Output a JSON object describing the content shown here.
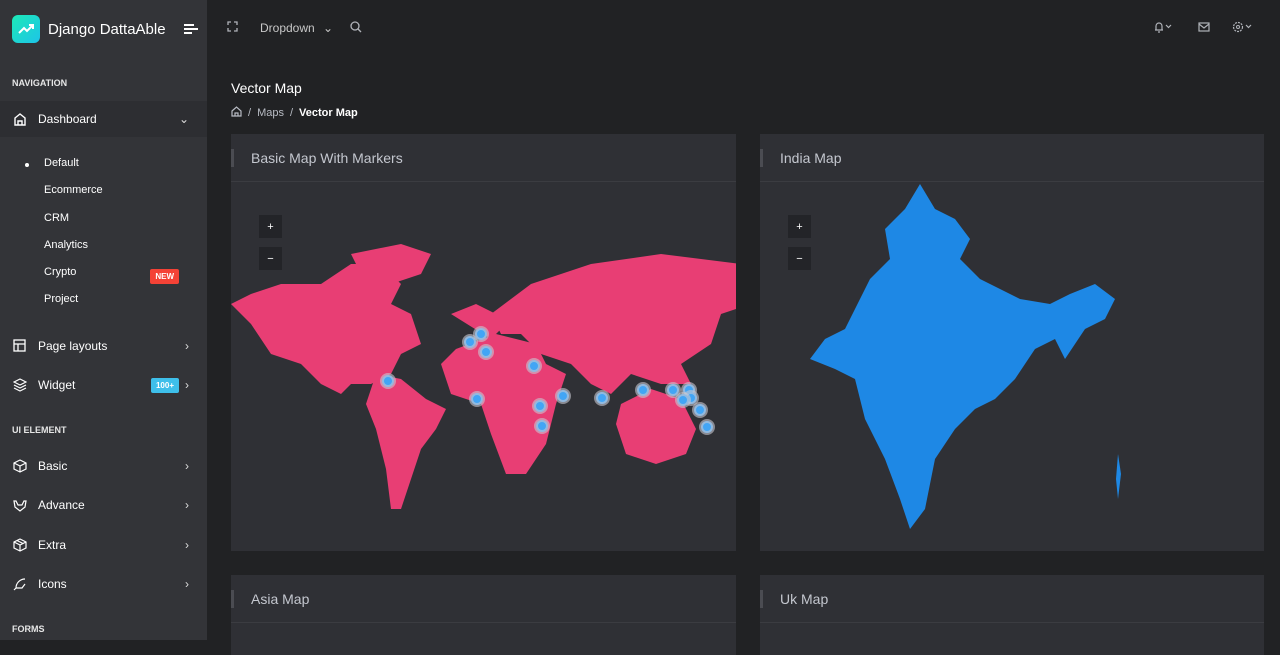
{
  "brand": {
    "name": "Django DattaAble"
  },
  "topbar": {
    "dropdown": "Dropdown"
  },
  "sidebar": {
    "captions": [
      "NAVIGATION",
      "UI ELEMENT",
      "FORMS"
    ],
    "dashboard": "Dashboard",
    "subitems": [
      "Default",
      "Ecommerce",
      "CRM",
      "Analytics",
      "Crypto",
      "Project"
    ],
    "crypto_badge": "NEW",
    "items": [
      {
        "label": "Page layouts"
      },
      {
        "label": "Widget",
        "badge": "100+"
      },
      {
        "label": "Basic"
      },
      {
        "label": "Advance"
      },
      {
        "label": "Extra"
      },
      {
        "label": "Icons"
      }
    ]
  },
  "page": {
    "title": "Vector Map",
    "breadcrumb": [
      "Maps",
      "Vector Map"
    ]
  },
  "cards": [
    "Basic Map With Markers",
    "India Map",
    "Asia Map",
    "Uk Map"
  ],
  "zoom": {
    "in": "+",
    "out": "−"
  },
  "colors": {
    "world": "#e83e74",
    "india": "#1e88e5",
    "marker": "#42a5f5",
    "new": "#f44236",
    "badge100": "#3ebfea"
  }
}
